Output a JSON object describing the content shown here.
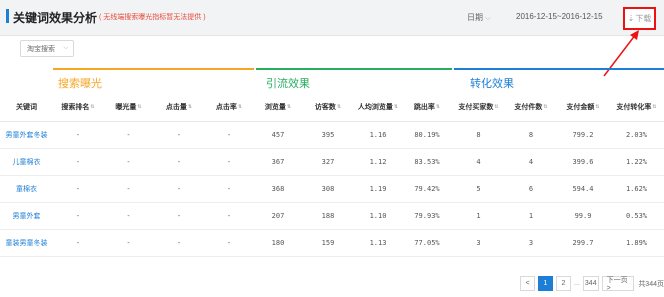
{
  "header": {
    "title": "关键词效果分析",
    "note": "( 无线端搜索曝光指标暂无法提供 )",
    "date_select": "日期",
    "date_range": "2016-12-15~2016-12-15",
    "download_label": "下载"
  },
  "filter": {
    "label": "淘宝搜索"
  },
  "groups": [
    {
      "label": "搜索曝光",
      "color": "#f5a623"
    },
    {
      "label": "引流效果",
      "color": "#27ae60"
    },
    {
      "label": "转化效果",
      "color": "#1c7ed6"
    }
  ],
  "columns": [
    {
      "label": "关键词",
      "sortable": false
    },
    {
      "label": "搜索排名",
      "sortable": true
    },
    {
      "label": "曝光量",
      "sortable": true
    },
    {
      "label": "点击量",
      "sortable": true
    },
    {
      "label": "点击率",
      "sortable": true
    },
    {
      "label": "浏览量",
      "sortable": true
    },
    {
      "label": "访客数",
      "sortable": true
    },
    {
      "label": "人均浏览量",
      "sortable": true
    },
    {
      "label": "跳出率",
      "sortable": true
    },
    {
      "label": "支付买家数",
      "sortable": true
    },
    {
      "label": "支付件数",
      "sortable": true
    },
    {
      "label": "支付金额",
      "sortable": true
    },
    {
      "label": "支付转化率",
      "sortable": true
    }
  ],
  "rows": [
    [
      "男童外套冬装",
      "-",
      "-",
      "-",
      "-",
      "457",
      "395",
      "1.16",
      "80.19%",
      "8",
      "8",
      "799.2",
      "2.03%"
    ],
    [
      "儿童棉衣",
      "-",
      "-",
      "-",
      "-",
      "367",
      "327",
      "1.12",
      "83.53%",
      "4",
      "4",
      "399.6",
      "1.22%"
    ],
    [
      "童棉衣",
      "-",
      "-",
      "-",
      "-",
      "368",
      "308",
      "1.19",
      "79.42%",
      "5",
      "6",
      "594.4",
      "1.62%"
    ],
    [
      "男童外套",
      "-",
      "-",
      "-",
      "-",
      "207",
      "188",
      "1.10",
      "79.93%",
      "1",
      "1",
      "99.9",
      "0.53%"
    ],
    [
      "童装男童冬装",
      "-",
      "-",
      "-",
      "-",
      "180",
      "159",
      "1.13",
      "77.05%",
      "3",
      "3",
      "299.7",
      "1.89%"
    ]
  ],
  "pagination": {
    "prev": "<",
    "pages": [
      "1",
      "2"
    ],
    "active": "1",
    "ellipsis": "...",
    "last": "344",
    "next": "下一页 >",
    "total": "共344页"
  }
}
